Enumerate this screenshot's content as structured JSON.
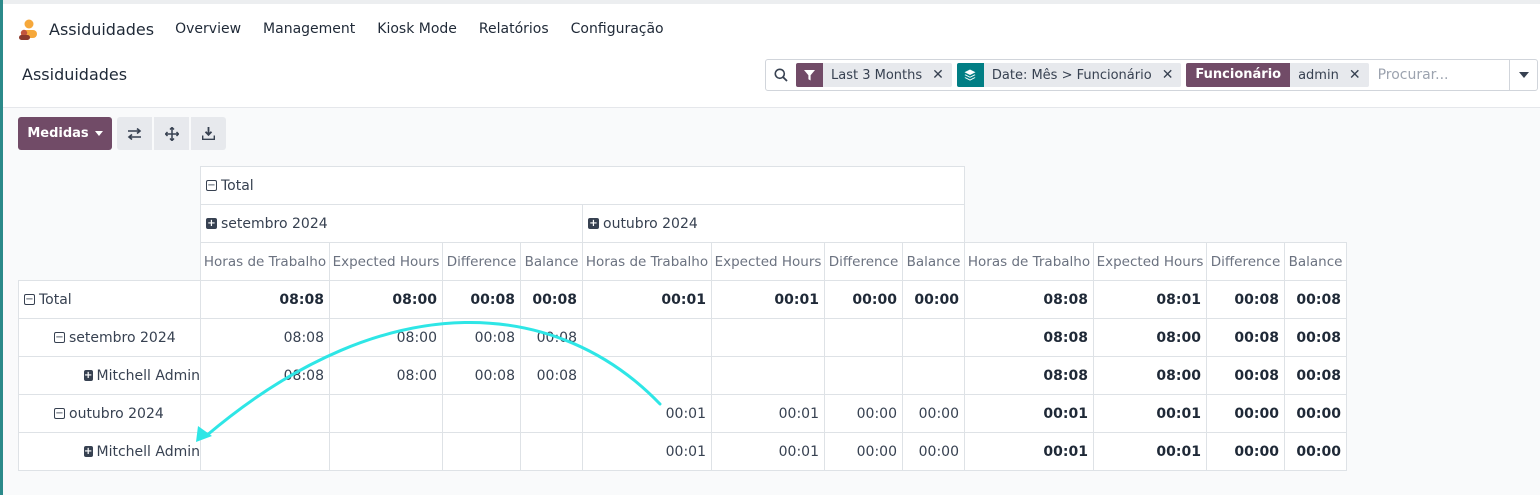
{
  "topbar": {
    "app_icon": "attendance-app-icon",
    "app_title": "Assiduidades",
    "menu": [
      "Overview",
      "Management",
      "Kiosk Mode",
      "Relatórios",
      "Configuração"
    ]
  },
  "control_panel": {
    "breadcrumb": "Assiduidades",
    "search": {
      "facets": [
        {
          "icon": "filter-icon",
          "value": "Last 3 Months"
        },
        {
          "icon": "layers-icon",
          "value": "Date: Mês > Funcionário"
        },
        {
          "label": "Funcionário",
          "value": "admin"
        }
      ],
      "placeholder": "Procurar..."
    },
    "measures_label": "Medidas",
    "tool_icons": [
      "flip-axis-icon",
      "expand-icon",
      "download-icon"
    ]
  },
  "pivot": {
    "col_header_total": "Total",
    "col_groups": [
      "setembro 2024",
      "outubro 2024"
    ],
    "measures": [
      "Horas de Trabalho",
      "Expected Hours",
      "Difference",
      "Balance"
    ],
    "rows": [
      {
        "label": "Total",
        "level": 0,
        "toggle": "minus",
        "bold": true,
        "cells": [
          "08:08",
          "08:00",
          "00:08",
          "00:08",
          "00:01",
          "00:01",
          "00:00",
          "00:00",
          "08:08",
          "08:01",
          "00:08",
          "00:08"
        ]
      },
      {
        "label": "setembro 2024",
        "level": 1,
        "toggle": "minus",
        "bold": false,
        "cells": [
          "08:08",
          "08:00",
          "00:08",
          "00:08",
          "",
          "",
          "",
          "",
          "08:08",
          "08:00",
          "00:08",
          "00:08"
        ]
      },
      {
        "label": "Mitchell Admin",
        "level": 2,
        "toggle": "plus",
        "bold": false,
        "cells": [
          "08:08",
          "08:00",
          "00:08",
          "00:08",
          "",
          "",
          "",
          "",
          "08:08",
          "08:00",
          "00:08",
          "00:08"
        ]
      },
      {
        "label": "outubro 2024",
        "level": 1,
        "toggle": "minus",
        "bold": false,
        "cells": [
          "",
          "",
          "",
          "",
          "00:01",
          "00:01",
          "00:00",
          "00:00",
          "00:01",
          "00:01",
          "00:00",
          "00:00"
        ]
      },
      {
        "label": "Mitchell Admin",
        "level": 2,
        "toggle": "plus",
        "bold": false,
        "cells": [
          "",
          "",
          "",
          "",
          "00:01",
          "00:01",
          "00:00",
          "00:00",
          "00:01",
          "00:01",
          "00:00",
          "00:00"
        ]
      }
    ]
  },
  "colors": {
    "brand": "#714b67",
    "teal": "#017e84",
    "annotation_arrow": "#2ee6e6"
  }
}
